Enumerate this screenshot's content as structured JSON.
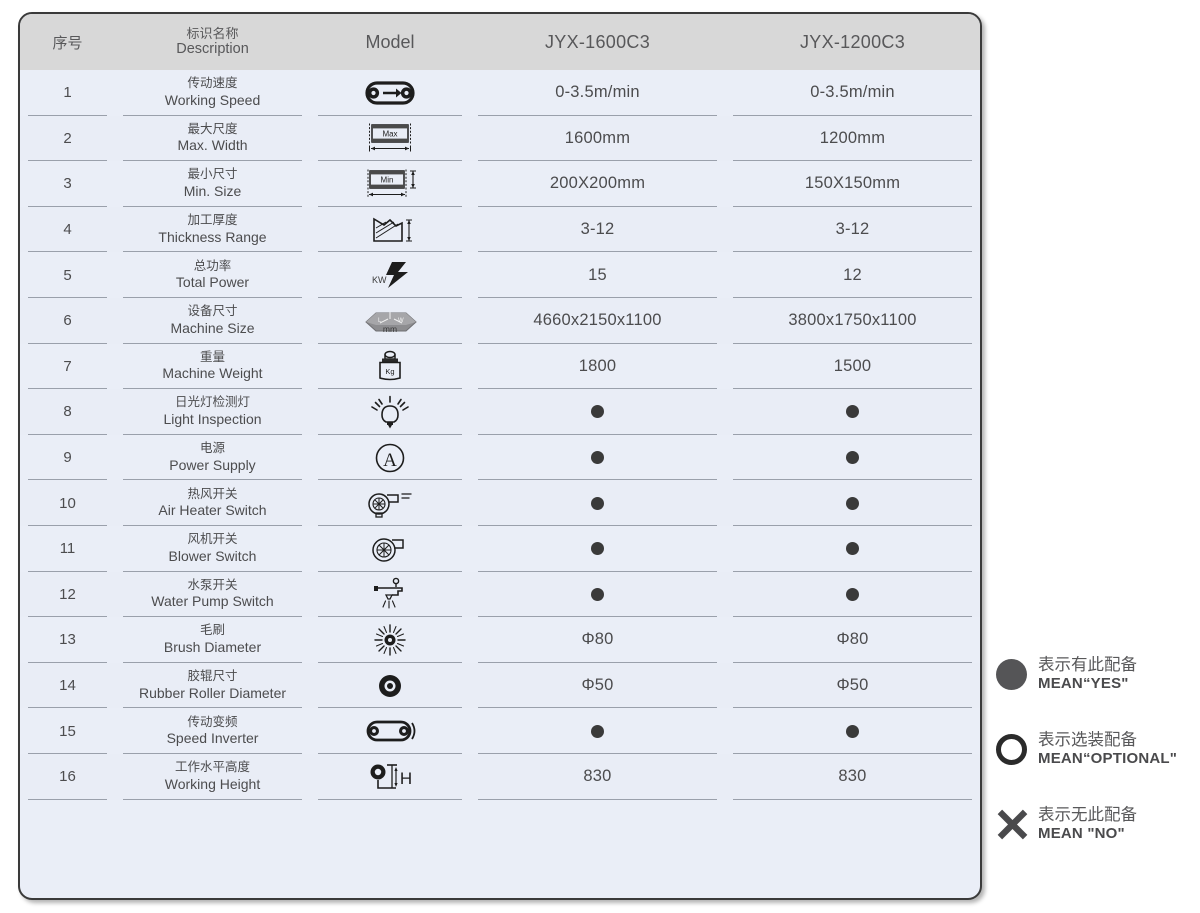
{
  "table": {
    "header": {
      "no": "序号",
      "description_cn": "标识名称",
      "description_en": "Description",
      "model": "Model",
      "col_a": "JYX-1600C3",
      "col_b": "JYX-1200C3"
    },
    "rows": [
      {
        "no": "1",
        "cn": "传动速度",
        "en": "Working Speed",
        "icon": "conveyor-arrow-icon",
        "a": "0-3.5m/min",
        "b": "0-3.5m/min"
      },
      {
        "no": "2",
        "cn": "最大尺度",
        "en": "Max. Width",
        "icon": "max-width-icon",
        "a": "1600mm",
        "b": "1200mm"
      },
      {
        "no": "3",
        "cn": "最小尺寸",
        "en": "Min. Size",
        "icon": "min-size-icon",
        "a": "200X200mm",
        "b": "150X150mm"
      },
      {
        "no": "4",
        "cn": "加工厚度",
        "en": "Thickness Range",
        "icon": "thickness-icon",
        "a": "3-12",
        "b": "3-12"
      },
      {
        "no": "5",
        "cn": "总功率",
        "en": "Total Power",
        "icon": "kw-bolt-icon",
        "a": "15",
        "b": "12"
      },
      {
        "no": "6",
        "cn": "设备尺寸",
        "en": "Machine Size",
        "icon": "machine-size-icon",
        "a": "4660x2150x1100",
        "b": "3800x1750x1100"
      },
      {
        "no": "7",
        "cn": "重量",
        "en": "Machine Weight",
        "icon": "weight-kg-icon",
        "a": "1800",
        "b": "1500"
      },
      {
        "no": "8",
        "cn": "日光灯检测灯",
        "en": "Light Inspection",
        "icon": "lightbulb-icon",
        "a": "dot",
        "b": "dot"
      },
      {
        "no": "9",
        "cn": "电源",
        "en": "Power Supply",
        "icon": "ampere-circle-icon",
        "a": "dot",
        "b": "dot"
      },
      {
        "no": "10",
        "cn": "热风开关",
        "en": "Air Heater Switch",
        "icon": "air-heater-icon",
        "a": "dot",
        "b": "dot"
      },
      {
        "no": "11",
        "cn": "风机开关",
        "en": "Blower Switch",
        "icon": "blower-icon",
        "a": "dot",
        "b": "dot"
      },
      {
        "no": "12",
        "cn": "水泵开关",
        "en": "Water Pump Switch",
        "icon": "water-tap-icon",
        "a": "dot",
        "b": "dot"
      },
      {
        "no": "13",
        "cn": "毛刷",
        "en": "Brush Diameter",
        "icon": "brush-burst-icon",
        "a": "Φ80",
        "b": "Φ80"
      },
      {
        "no": "14",
        "cn": "胶辊尺寸",
        "en": "Rubber Roller Diameter",
        "icon": "roller-disc-icon",
        "a": "Φ50",
        "b": "Φ50"
      },
      {
        "no": "15",
        "cn": "传动变频",
        "en": "Speed Inverter",
        "icon": "belt-rotate-icon",
        "a": "dot",
        "b": "dot"
      },
      {
        "no": "16",
        "cn": "工作水平高度",
        "en": "Working Height",
        "icon": "working-height-icon",
        "a": "830",
        "b": "830"
      }
    ]
  },
  "legend": [
    {
      "mark": "filled-circle",
      "cn": "表示有此配备",
      "en": "MEAN“YES\""
    },
    {
      "mark": "hollow-circle",
      "cn": "表示选装配备",
      "en": "MEAN“OPTIONAL\""
    },
    {
      "mark": "cross",
      "cn": "表示无此配备",
      "en": "MEAN \"NO\""
    }
  ],
  "colors": {
    "table_background": "#eaeef7",
    "header_background": "#d8d8d8",
    "border": "#3a3a3a",
    "text": "#4c4c4e",
    "dot": "#3a3a3a",
    "legend_filled": "#555557",
    "page_background": "#ffffff"
  }
}
